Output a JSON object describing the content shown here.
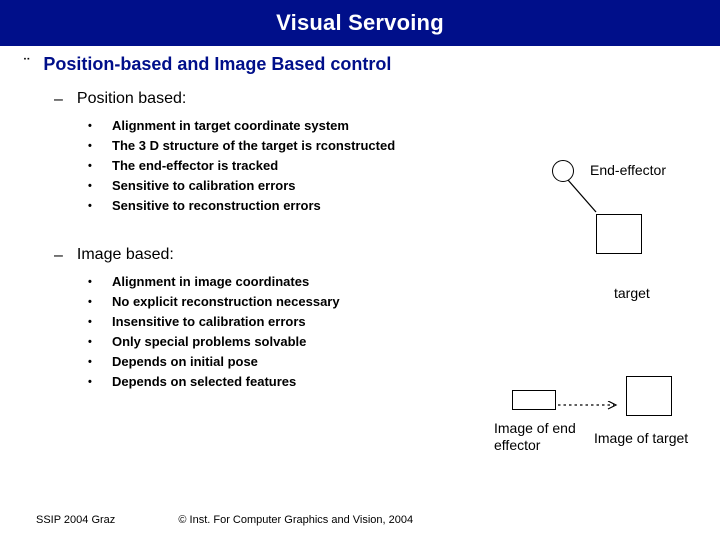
{
  "title": "Visual Servoing",
  "main_heading": "Position-based and Image Based control",
  "sections": {
    "position_based": {
      "heading": "Position based:",
      "items": [
        "Alignment in target coordinate system",
        "The 3 D structure of the target is rconstructed",
        "The end-effector is tracked",
        "Sensitive to calibration errors",
        "Sensitive to reconstruction errors"
      ]
    },
    "image_based": {
      "heading": "Image based:",
      "items": [
        " Alignment in image coordinates",
        "No explicit reconstruction necessary",
        "Insensitive to calibration errors",
        "Only special problems solvable",
        "Depends on initial pose",
        "Depends on selected features"
      ]
    }
  },
  "diagrams": {
    "end_effector_label": "End-effector",
    "target_label": "target",
    "image_end_effector_label": "Image of end\neffector",
    "image_target_label": "Image of target"
  },
  "footer": {
    "left": "SSIP 2004 Graz",
    "center": "© Inst. For Computer Graphics and Vision, 2004"
  }
}
